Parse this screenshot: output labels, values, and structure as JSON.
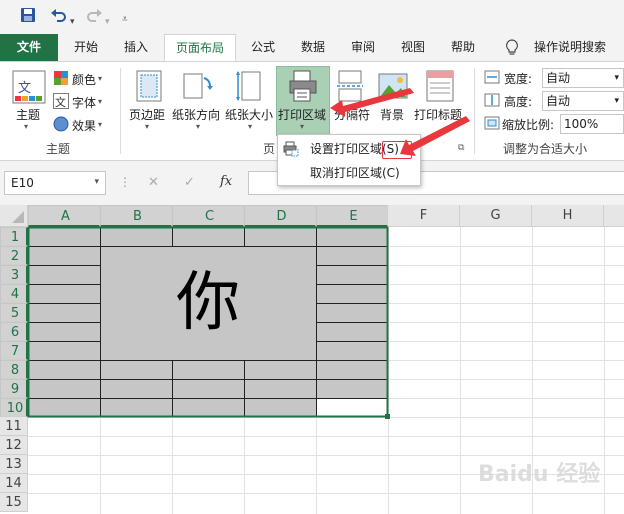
{
  "quick_access": {
    "icons": [
      "save-icon",
      "undo-icon",
      "redo-icon",
      "customize-icon"
    ]
  },
  "tabs": [
    {
      "label": "文件",
      "state": "file"
    },
    {
      "label": "开始"
    },
    {
      "label": "插入"
    },
    {
      "label": "页面布局",
      "state": "active"
    },
    {
      "label": "公式"
    },
    {
      "label": "数据"
    },
    {
      "label": "审阅"
    },
    {
      "label": "视图"
    },
    {
      "label": "帮助"
    },
    {
      "label": "操作说明搜索",
      "icon": "lightbulb-icon"
    }
  ],
  "ribbon": {
    "theme_group": {
      "theme_label": "主题",
      "colors_label": "颜色",
      "fonts_label": "字体",
      "effects_label": "效果",
      "group_label": "主题"
    },
    "page_setup_group": {
      "margins_label": "页边距",
      "orientation_label": "纸张方向",
      "size_label": "纸张大小",
      "print_area_label": "打印区域",
      "breaks_label": "分隔符",
      "background_label": "背景",
      "print_titles_label": "打印标题",
      "group_label": "页"
    },
    "scale_group": {
      "width_label": "宽度:",
      "width_value": "自动",
      "height_label": "高度:",
      "height_value": "自动",
      "scale_label": "缩放比例:",
      "scale_value": "100%",
      "group_label": "调整为合适大小"
    }
  },
  "print_area_menu": {
    "items": [
      {
        "label": "设置打印区域(S)",
        "highlight": true
      },
      {
        "label": "取消打印区域(C)"
      }
    ]
  },
  "formula_bar": {
    "name_box": "E10",
    "cancel_symbol": "✕",
    "enter_symbol": "✓",
    "fx_symbol": "fx"
  },
  "grid": {
    "columns": [
      "A",
      "B",
      "C",
      "D",
      "E",
      "F",
      "G",
      "H"
    ],
    "selected_columns": [
      "A",
      "B",
      "C",
      "D",
      "E"
    ],
    "rows": [
      "1",
      "2",
      "3",
      "4",
      "5",
      "6",
      "7",
      "8",
      "9",
      "10",
      "11",
      "12",
      "13",
      "14",
      "15"
    ],
    "selected_rows": [
      "1",
      "2",
      "3",
      "4",
      "5",
      "6",
      "7",
      "8",
      "9",
      "10"
    ],
    "merged_cell_text": "你",
    "active_cell": "E10",
    "selection_fill": "#c6c6c6",
    "accent": "#217346"
  },
  "annotation_color": "#e8383d",
  "watermark": "Baidu 经验"
}
